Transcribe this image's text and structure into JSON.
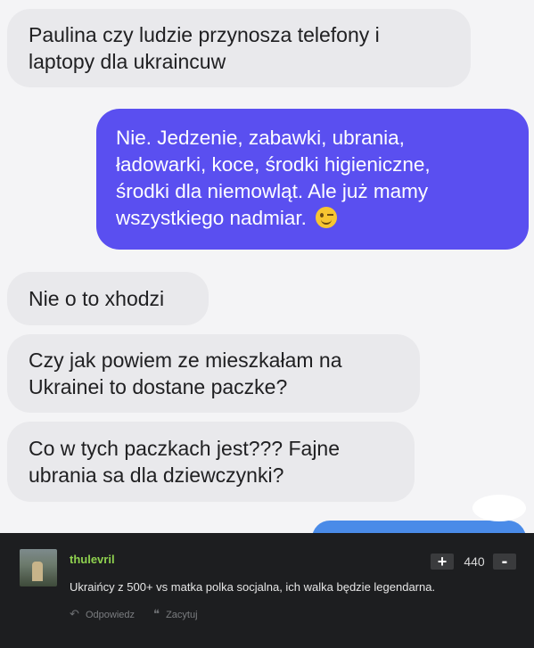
{
  "chat": {
    "messages": [
      {
        "side": "incoming",
        "lines": [
          "Paulina czy ludzie przynosza telefony i",
          "laptopy dla ukraincuw"
        ]
      },
      {
        "side": "outgoing",
        "lines": [
          "Nie. Jedzenie, zabawki, ubrania,",
          "ładowarki, koce, środki higieniczne,",
          "środki dla niemowląt. Ale już mamy",
          "wszystkiego nadmiar."
        ],
        "emoji": "winking-face-emoji"
      },
      {
        "side": "incoming",
        "lines": [
          "Nie o to xhodzi"
        ]
      },
      {
        "side": "incoming",
        "lines": [
          "Czy jak powiem ze mieszkałam na",
          "Ukrainei to dostane paczke?"
        ]
      },
      {
        "side": "incoming",
        "lines": [
          "Co w tych paczkach jest??? Fajne",
          "ubrania sa dla dziewczynki?"
        ]
      }
    ],
    "colors": {
      "incoming": "#e9e9ec",
      "outgoing": "#5a4ff0",
      "background": "#f4f4f6"
    }
  },
  "comment": {
    "username": "thulevril",
    "text": "Ukraińcy z 500+ vs matka polka socjalna, ich walka będzie legendarna.",
    "score": "440",
    "upvote_label": "+",
    "downvote_label": "-",
    "reply_label": "Odpowiedz",
    "quote_label": "Zacytuj",
    "reply_icon": "reply-arrow-icon",
    "quote_icon": "quote-icon",
    "colors": {
      "username": "#8fd14f",
      "background": "#1d1e20"
    }
  }
}
